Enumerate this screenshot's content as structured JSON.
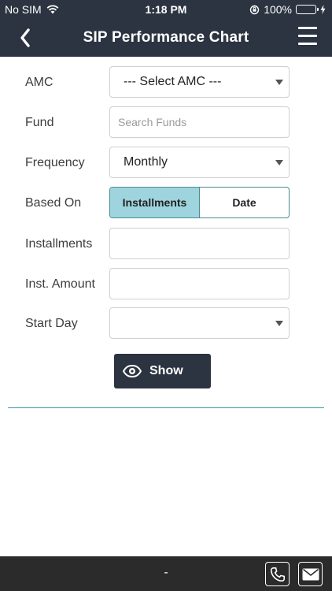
{
  "status_bar": {
    "carrier": "No SIM",
    "time": "1:18 PM",
    "battery": "100%"
  },
  "header": {
    "title": "SIP Performance Chart"
  },
  "form": {
    "amc": {
      "label": "AMC",
      "value": "--- Select AMC ---"
    },
    "fund": {
      "label": "Fund",
      "placeholder": "Search Funds",
      "value": ""
    },
    "frequency": {
      "label": "Frequency",
      "value": "Monthly"
    },
    "based_on": {
      "label": "Based On",
      "options": [
        "Installments",
        "Date"
      ],
      "selected": "Installments"
    },
    "installments": {
      "label": "Installments",
      "value": ""
    },
    "inst_amount": {
      "label": "Inst. Amount",
      "value": ""
    },
    "start_day": {
      "label": "Start Day",
      "value": ""
    },
    "show_label": "Show"
  },
  "footer": {
    "text": "-"
  },
  "colors": {
    "header_bg": "#2c3441",
    "segment_active": "#9dd4dd",
    "divider": "#3d9aa3",
    "footer_bg": "#2b2b2b",
    "battery": "#4cd964"
  }
}
